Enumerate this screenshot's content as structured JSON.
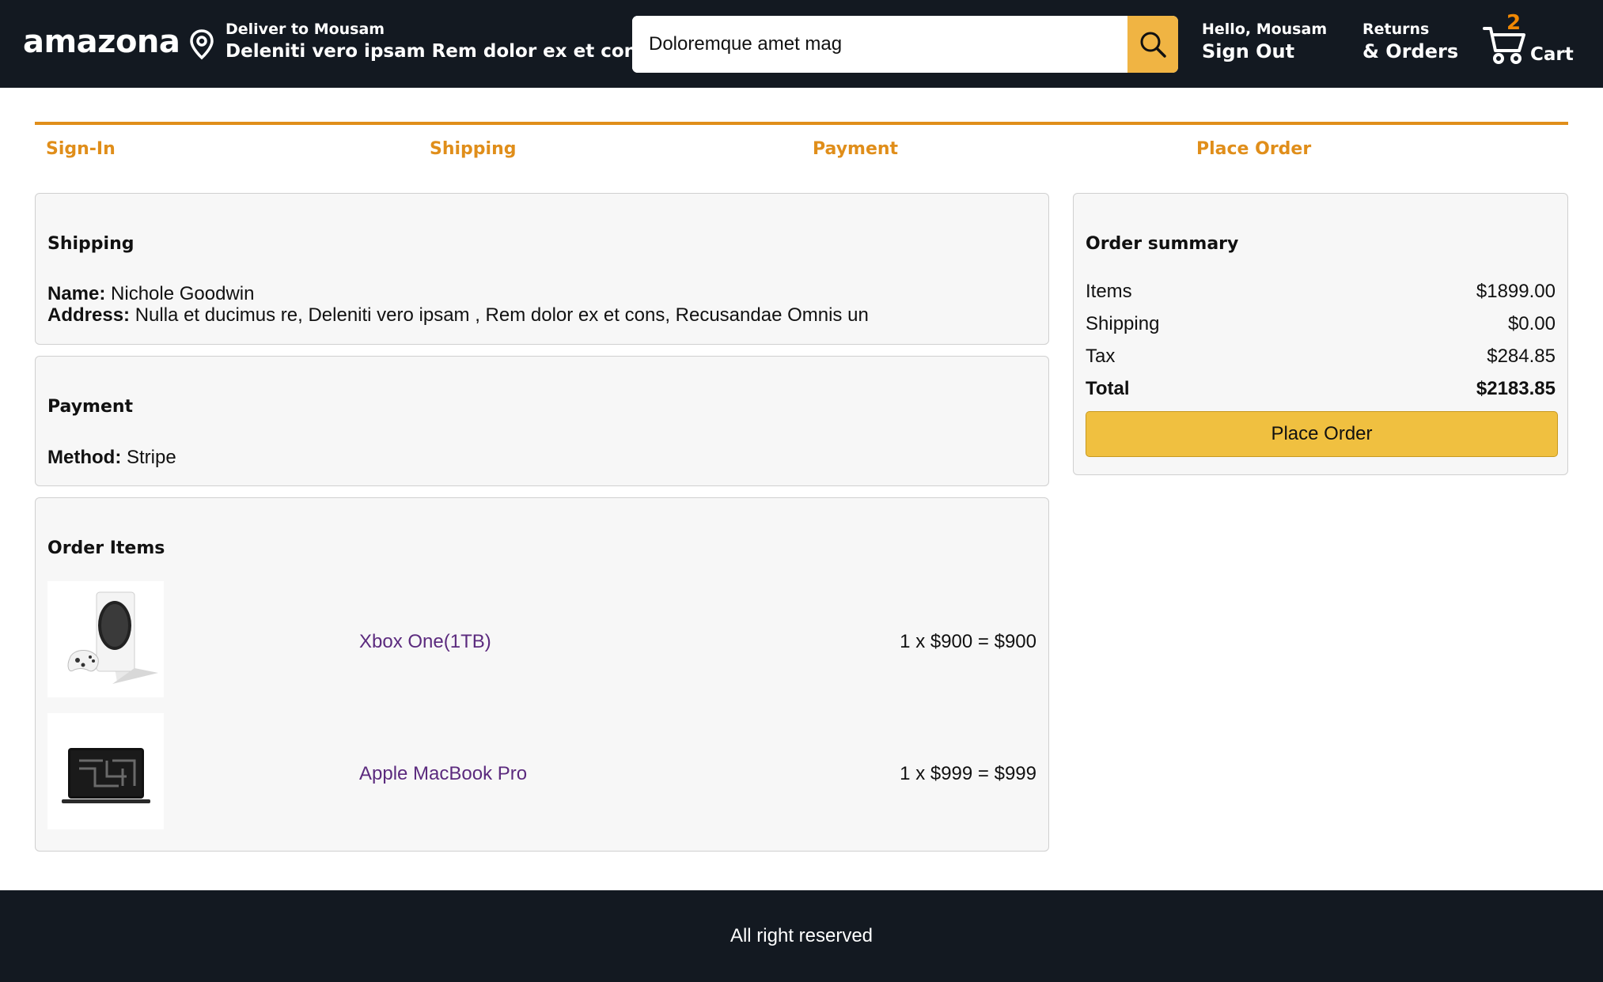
{
  "header": {
    "logo": "amazona",
    "deliver_to": "Deliver to Mousam",
    "address_short": "Deleniti vero ipsam Rem dolor ex et cons",
    "search_value": "Doloremque amet mag",
    "greeting": "Hello, Mousam",
    "sign_out": "Sign Out",
    "returns_line1": "Returns",
    "returns_line2": "& Orders",
    "cart_count": "2",
    "cart_label": "Cart"
  },
  "steps": [
    "Sign-In",
    "Shipping",
    "Payment",
    "Place Order"
  ],
  "shipping": {
    "title": "Shipping",
    "name_label": "Name:",
    "name": "Nichole Goodwin",
    "address_label": "Address:",
    "address": "Nulla et ducimus re, Deleniti vero ipsam , Rem dolor ex et cons, Recusandae Omnis un"
  },
  "payment": {
    "title": "Payment",
    "method_label": "Method:",
    "method": "Stripe"
  },
  "order_items": {
    "title": "Order Items",
    "items": [
      {
        "name": "Xbox One(1TB)",
        "price_line": "1 x $900 = $900",
        "image_icon": "xbox-console-image"
      },
      {
        "name": "Apple MacBook Pro",
        "price_line": "1 x $999 = $999",
        "image_icon": "macbook-image"
      }
    ]
  },
  "summary": {
    "title": "Order summary",
    "rows": [
      {
        "label": "Items",
        "value": "$1899.00"
      },
      {
        "label": "Shipping",
        "value": "$0.00"
      },
      {
        "label": "Tax",
        "value": "$284.85"
      },
      {
        "label": "Total",
        "value": "$2183.85"
      }
    ],
    "button": "Place Order"
  },
  "footer": {
    "text": "All right reserved"
  },
  "colors": {
    "header_bg": "#131921",
    "accent_orange": "#e08e1a",
    "search_button": "#f0b443",
    "place_order_button": "#f0c040",
    "link_purple": "#5b2a7e"
  }
}
